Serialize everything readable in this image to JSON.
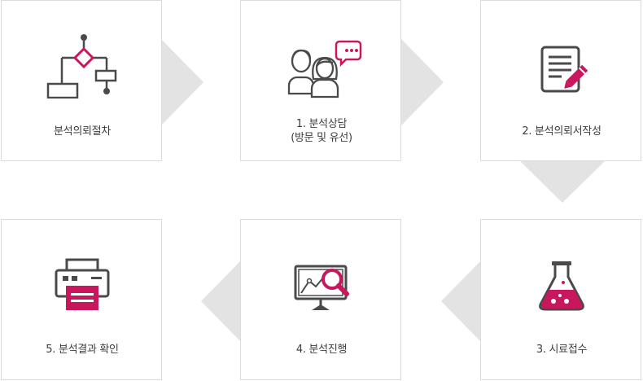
{
  "steps": [
    {
      "label": "분석의뢰절차",
      "icon": "flowchart-icon"
    },
    {
      "label_line1": "1. 분석상담",
      "label_line2": "(방문 및 유선)",
      "icon": "consultation-icon"
    },
    {
      "label": "2. 분석의뢰서작성",
      "icon": "document-pencil-icon"
    },
    {
      "label": "3. 시료접수",
      "icon": "flask-icon"
    },
    {
      "label": "4. 분석진행",
      "icon": "monitor-magnifier-icon"
    },
    {
      "label": "5. 분석결과 확인",
      "icon": "printer-icon"
    }
  ],
  "colors": {
    "accent": "#c8175d",
    "icon_dark": "#4a4a4a",
    "arrow": "#e3e3e3",
    "border": "#dcdcdc"
  }
}
